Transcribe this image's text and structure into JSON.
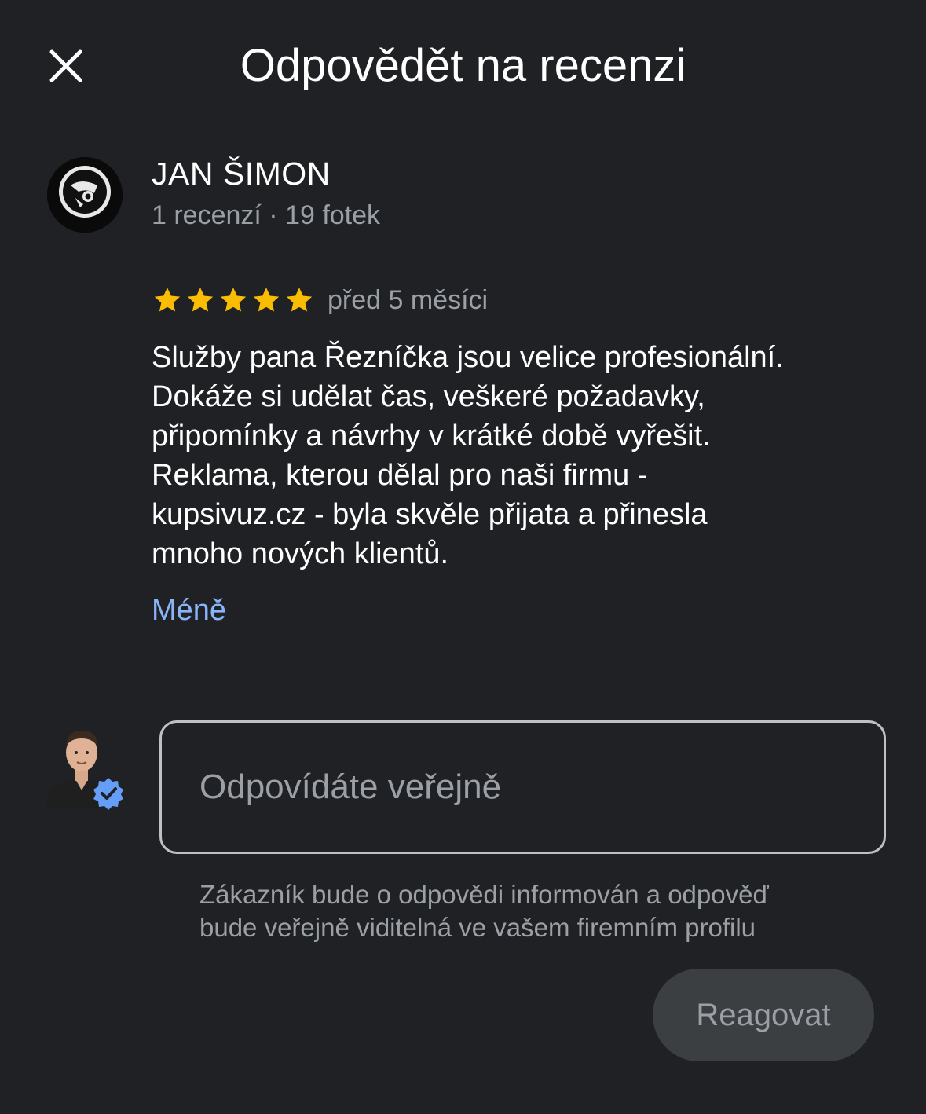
{
  "header": {
    "title": "Odpovědět na recenzi",
    "close_icon": "close-icon"
  },
  "review": {
    "author_name": "JAN ŠIMON",
    "author_meta": "1 recenzí · 19 fotek",
    "rating": 5,
    "rating_max": 5,
    "date": "před 5 měsíci",
    "text_lines": [
      "Služby pana Řezníčka jsou velice profesionální.",
      "Dokáže si udělat čas, veškeré požadavky,",
      "připomínky a návrhy v krátké době vyřešit.",
      "Reklama, kterou dělal pro naši firmu -",
      "kupsivuz.cz - byla skvěle přijata a přinesla",
      "mnoho nových klientů."
    ],
    "less_label": "Méně"
  },
  "reply": {
    "placeholder": "Odpovídáte veřejně",
    "value": "",
    "hint_lines": [
      "Zákazník bude o odpovědi informován a odpověď",
      "bude veřejně viditelná ve vašem firemním profilu"
    ],
    "submit_label": "Reagovat"
  },
  "colors": {
    "background": "#202124",
    "star": "#fbbc04",
    "link": "#8ab4f8",
    "verified_badge": "#669df6",
    "button_bg": "#3c3f42"
  }
}
